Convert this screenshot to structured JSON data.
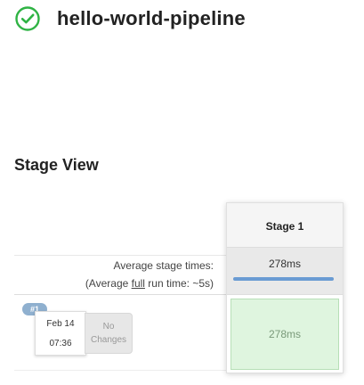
{
  "header": {
    "title": "hello-world-pipeline",
    "status_icon": "success-check-circle-icon",
    "status_color": "#2fb344"
  },
  "stage_view": {
    "title": "Stage View",
    "average_label_line1": "Average stage times:",
    "average_label_line2_prefix": "(Average ",
    "average_label_line2_underlined": "full",
    "average_label_line2_suffix": " run time: ~5s)"
  },
  "stages": [
    {
      "name": "Stage 1",
      "average_time": "278ms",
      "average_progress_percent": 100
    }
  ],
  "runs": [
    {
      "badge": "#1",
      "date": "Feb 14",
      "time": "07:36",
      "changes": "No Changes",
      "stage_results": [
        "278ms"
      ]
    }
  ],
  "colors": {
    "success_fill": "#dff5df",
    "progress_bar": "#6a9bd3",
    "badge": "#8fb0cf"
  }
}
